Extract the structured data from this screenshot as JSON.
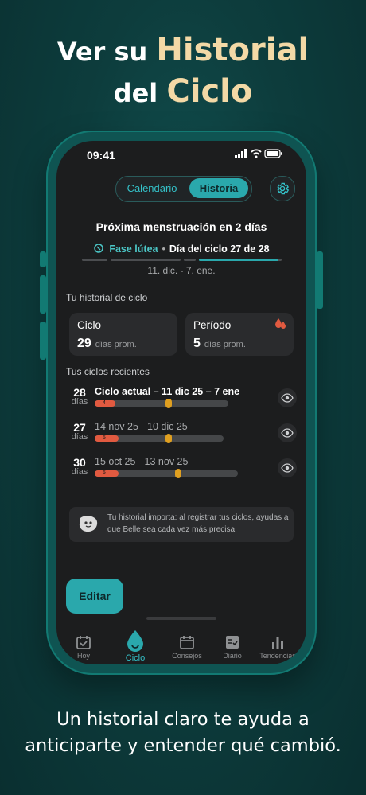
{
  "headline": {
    "l1a": "Ver su ",
    "l1b": "Historial",
    "l2a": "del ",
    "l2b": "Ciclo"
  },
  "caption": {
    "line1": "Un historial claro te ayuda a",
    "line2": "anticiparte y entender qué cambió."
  },
  "status": {
    "time": "09:41"
  },
  "segment": {
    "calendar": "Calendario",
    "history": "Historia"
  },
  "next": "Próxima menstruación en 2 días",
  "phase": {
    "name": "Fase lútea",
    "day": "Día del ciclo 27 de 28",
    "range": "11. dic. - 7. ene.",
    "progress": 0.96
  },
  "history": {
    "title": "Tu historial de ciclo",
    "cycle": {
      "label": "Ciclo",
      "value": "29",
      "unit": "días prom."
    },
    "period": {
      "label": "Período",
      "value": "5",
      "unit": "días prom."
    }
  },
  "recent": {
    "title": "Tus ciclos recientes",
    "items": [
      {
        "days": "28",
        "unit": "días",
        "label": "Ciclo actual – 11 dic 25 – 7 ene",
        "period": "4"
      },
      {
        "days": "27",
        "unit": "días",
        "label": "14 nov 25 - 10 dic 25",
        "period": "5"
      },
      {
        "days": "30",
        "unit": "días",
        "label": "15 oct 25 - 13 nov 25",
        "period": "5"
      }
    ]
  },
  "info": "Tu historial importa: al registrar tus ciclos, ayudas a que Belle sea cada vez más precisa.",
  "edit": "Editar",
  "tabs": {
    "hoy": "Hoy",
    "ciclo": "Ciclo",
    "consejos": "Consejos",
    "diario": "Diario",
    "tendencias": "Tendencias"
  },
  "colors": {
    "accent": "#2aa8ac",
    "period": "#e15a40",
    "ovulation": "#e0a020",
    "headline_highlight": "#f3d9a6"
  }
}
